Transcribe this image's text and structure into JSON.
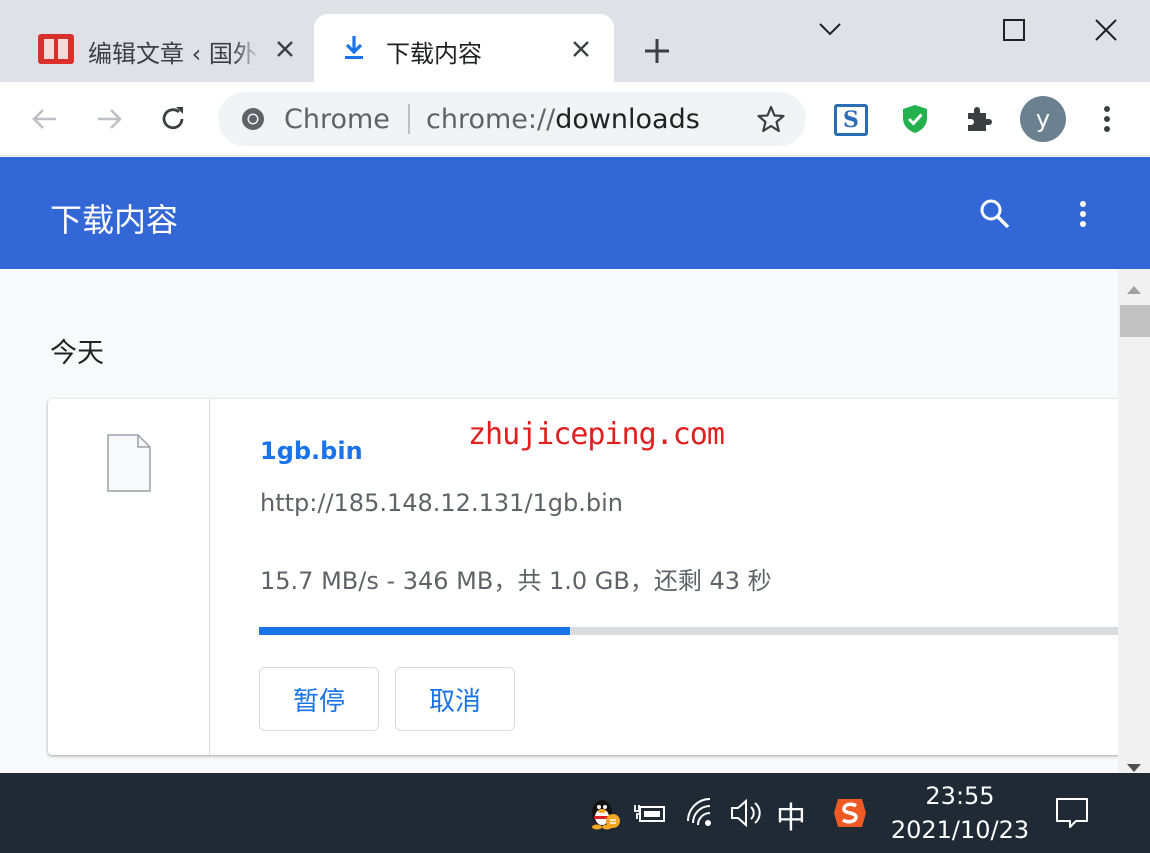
{
  "tabs": [
    {
      "title": "编辑文章 ‹ 国外主机测评",
      "icon": "book-favicon-icon",
      "active": false
    },
    {
      "title": "下载内容",
      "icon": "download-icon",
      "active": true
    }
  ],
  "toolbar": {
    "omnibox_chip": "Chrome",
    "url_scheme": "chrome://",
    "url_path": "downloads",
    "avatar_letter": "y"
  },
  "downloads": {
    "header_title": "下载内容",
    "section_label": "今天",
    "item": {
      "file_name": "1gb.bin",
      "url": "http://185.148.12.131/1gb.bin",
      "status": "15.7 MB/s - 346 MB，共 1.0 GB，还剩 43 秒",
      "progress": 0.346,
      "pause_label": "暂停",
      "cancel_label": "取消"
    },
    "watermark": "zhujiceping.com"
  },
  "taskbar": {
    "ime_label": "中",
    "time": "23:55",
    "date": "2021/10/23"
  },
  "colors": {
    "header_blue": "#3367d6",
    "link_blue": "#1a73e8",
    "tabstrip": "#dee1e6",
    "taskbar": "#1f2a35"
  }
}
